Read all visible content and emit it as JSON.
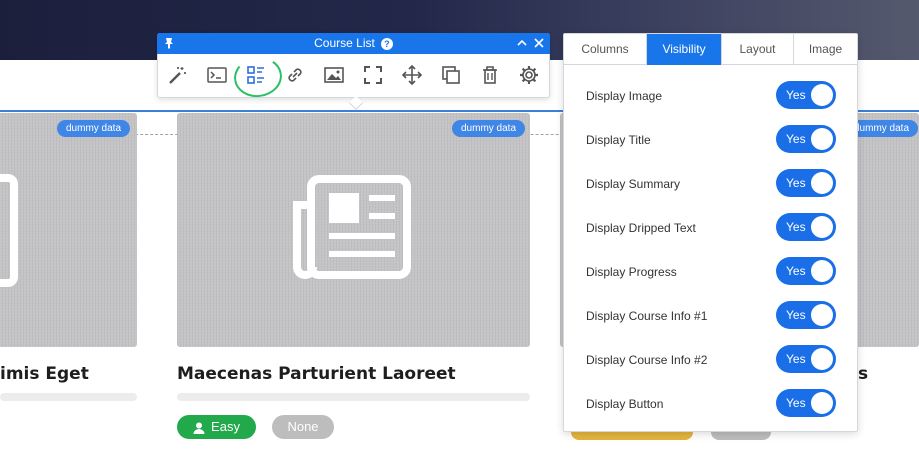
{
  "toolbar": {
    "title": "Course List",
    "help_symbol": "?",
    "tools": [
      {
        "name": "magic-wand-icon"
      },
      {
        "name": "terminal-icon"
      },
      {
        "name": "list-layout-icon"
      },
      {
        "name": "link-icon"
      },
      {
        "name": "image-icon"
      },
      {
        "name": "fullscreen-icon"
      },
      {
        "name": "move-icon"
      },
      {
        "name": "duplicate-icon"
      },
      {
        "name": "trash-icon"
      },
      {
        "name": "gear-icon"
      }
    ]
  },
  "panel": {
    "tabs": [
      {
        "label": "Columns",
        "active": false
      },
      {
        "label": "Visibility",
        "active": true
      },
      {
        "label": "Layout",
        "active": false
      },
      {
        "label": "Image",
        "active": false
      }
    ],
    "toggle_label": "Yes",
    "rows": [
      {
        "label": "Display Image"
      },
      {
        "label": "Display Title"
      },
      {
        "label": "Display Summary"
      },
      {
        "label": "Display Dripped Text"
      },
      {
        "label": "Display Progress"
      },
      {
        "label": "Display Course Info #1"
      },
      {
        "label": "Display Course Info #2"
      },
      {
        "label": "Display Button"
      }
    ]
  },
  "cards": {
    "left": {
      "title": "imis Eget",
      "badge": "dummy data"
    },
    "center": {
      "title": "Maecenas Parturient Laoreet",
      "badge": "dummy data",
      "difficulty": "Easy",
      "tag": "None"
    },
    "right": {
      "title": "s",
      "badge": "dummy data"
    }
  },
  "colors": {
    "accent": "#1976ea",
    "easy": "#22a94b",
    "none": "#bdbdbd",
    "highlight_circle": "#2bbf66"
  }
}
